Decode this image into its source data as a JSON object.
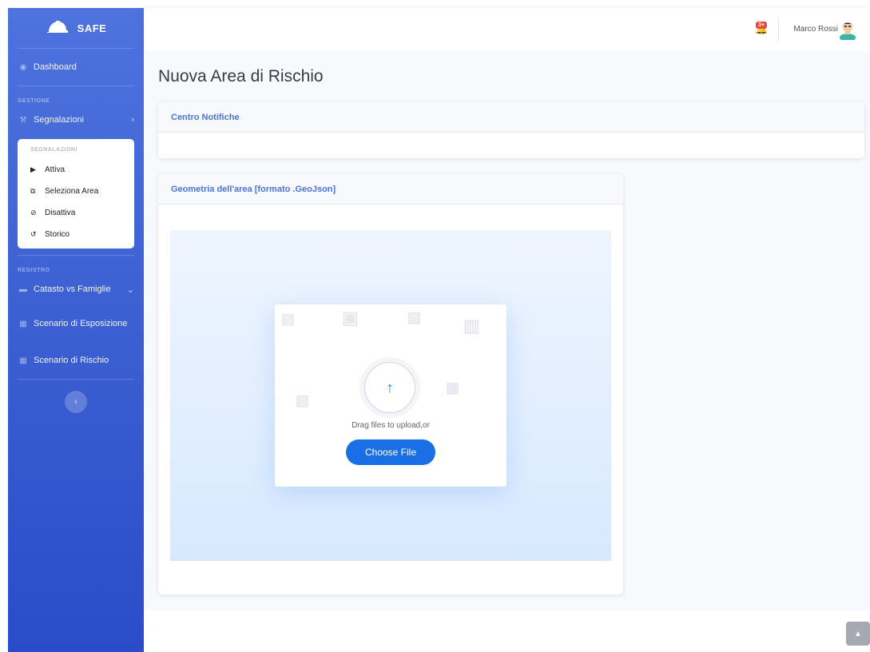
{
  "brand": {
    "name": "SAFE"
  },
  "sidebar": {
    "dashboard_label": "Dashboard",
    "gestione_head": "GESTIONE",
    "segnalazioni_label": "Segnalazioni",
    "sub": {
      "head": "SEGNALAZIONI",
      "items": [
        {
          "label": "Attiva",
          "icon": "play-icon"
        },
        {
          "label": "Seleziona Area",
          "icon": "select-area-icon"
        },
        {
          "label": "Disattiva",
          "icon": "bell-slash-icon"
        },
        {
          "label": "Storico",
          "icon": "history-icon"
        }
      ]
    },
    "registro_head": "REGISTRO",
    "catasto_label": "Catasto vs Famiglie",
    "esposizione_label": "Scenario di Esposizione",
    "rischio_label": "Scenario di Rischio"
  },
  "topbar": {
    "badge": "3+",
    "user_name": "Marco Rossi"
  },
  "main": {
    "title": "Nuova Area di Rischio",
    "notifiche_header": "Centro Notifiche",
    "geometria_header": "Geometria dell'area [formato .GeoJson]",
    "upload": {
      "drag_text": "Drag files to upload,or",
      "button_label": "Choose File"
    }
  },
  "colors": {
    "primary": "#4e73df",
    "upload_button": "#1a6fe6",
    "badge": "#e74a3b"
  }
}
